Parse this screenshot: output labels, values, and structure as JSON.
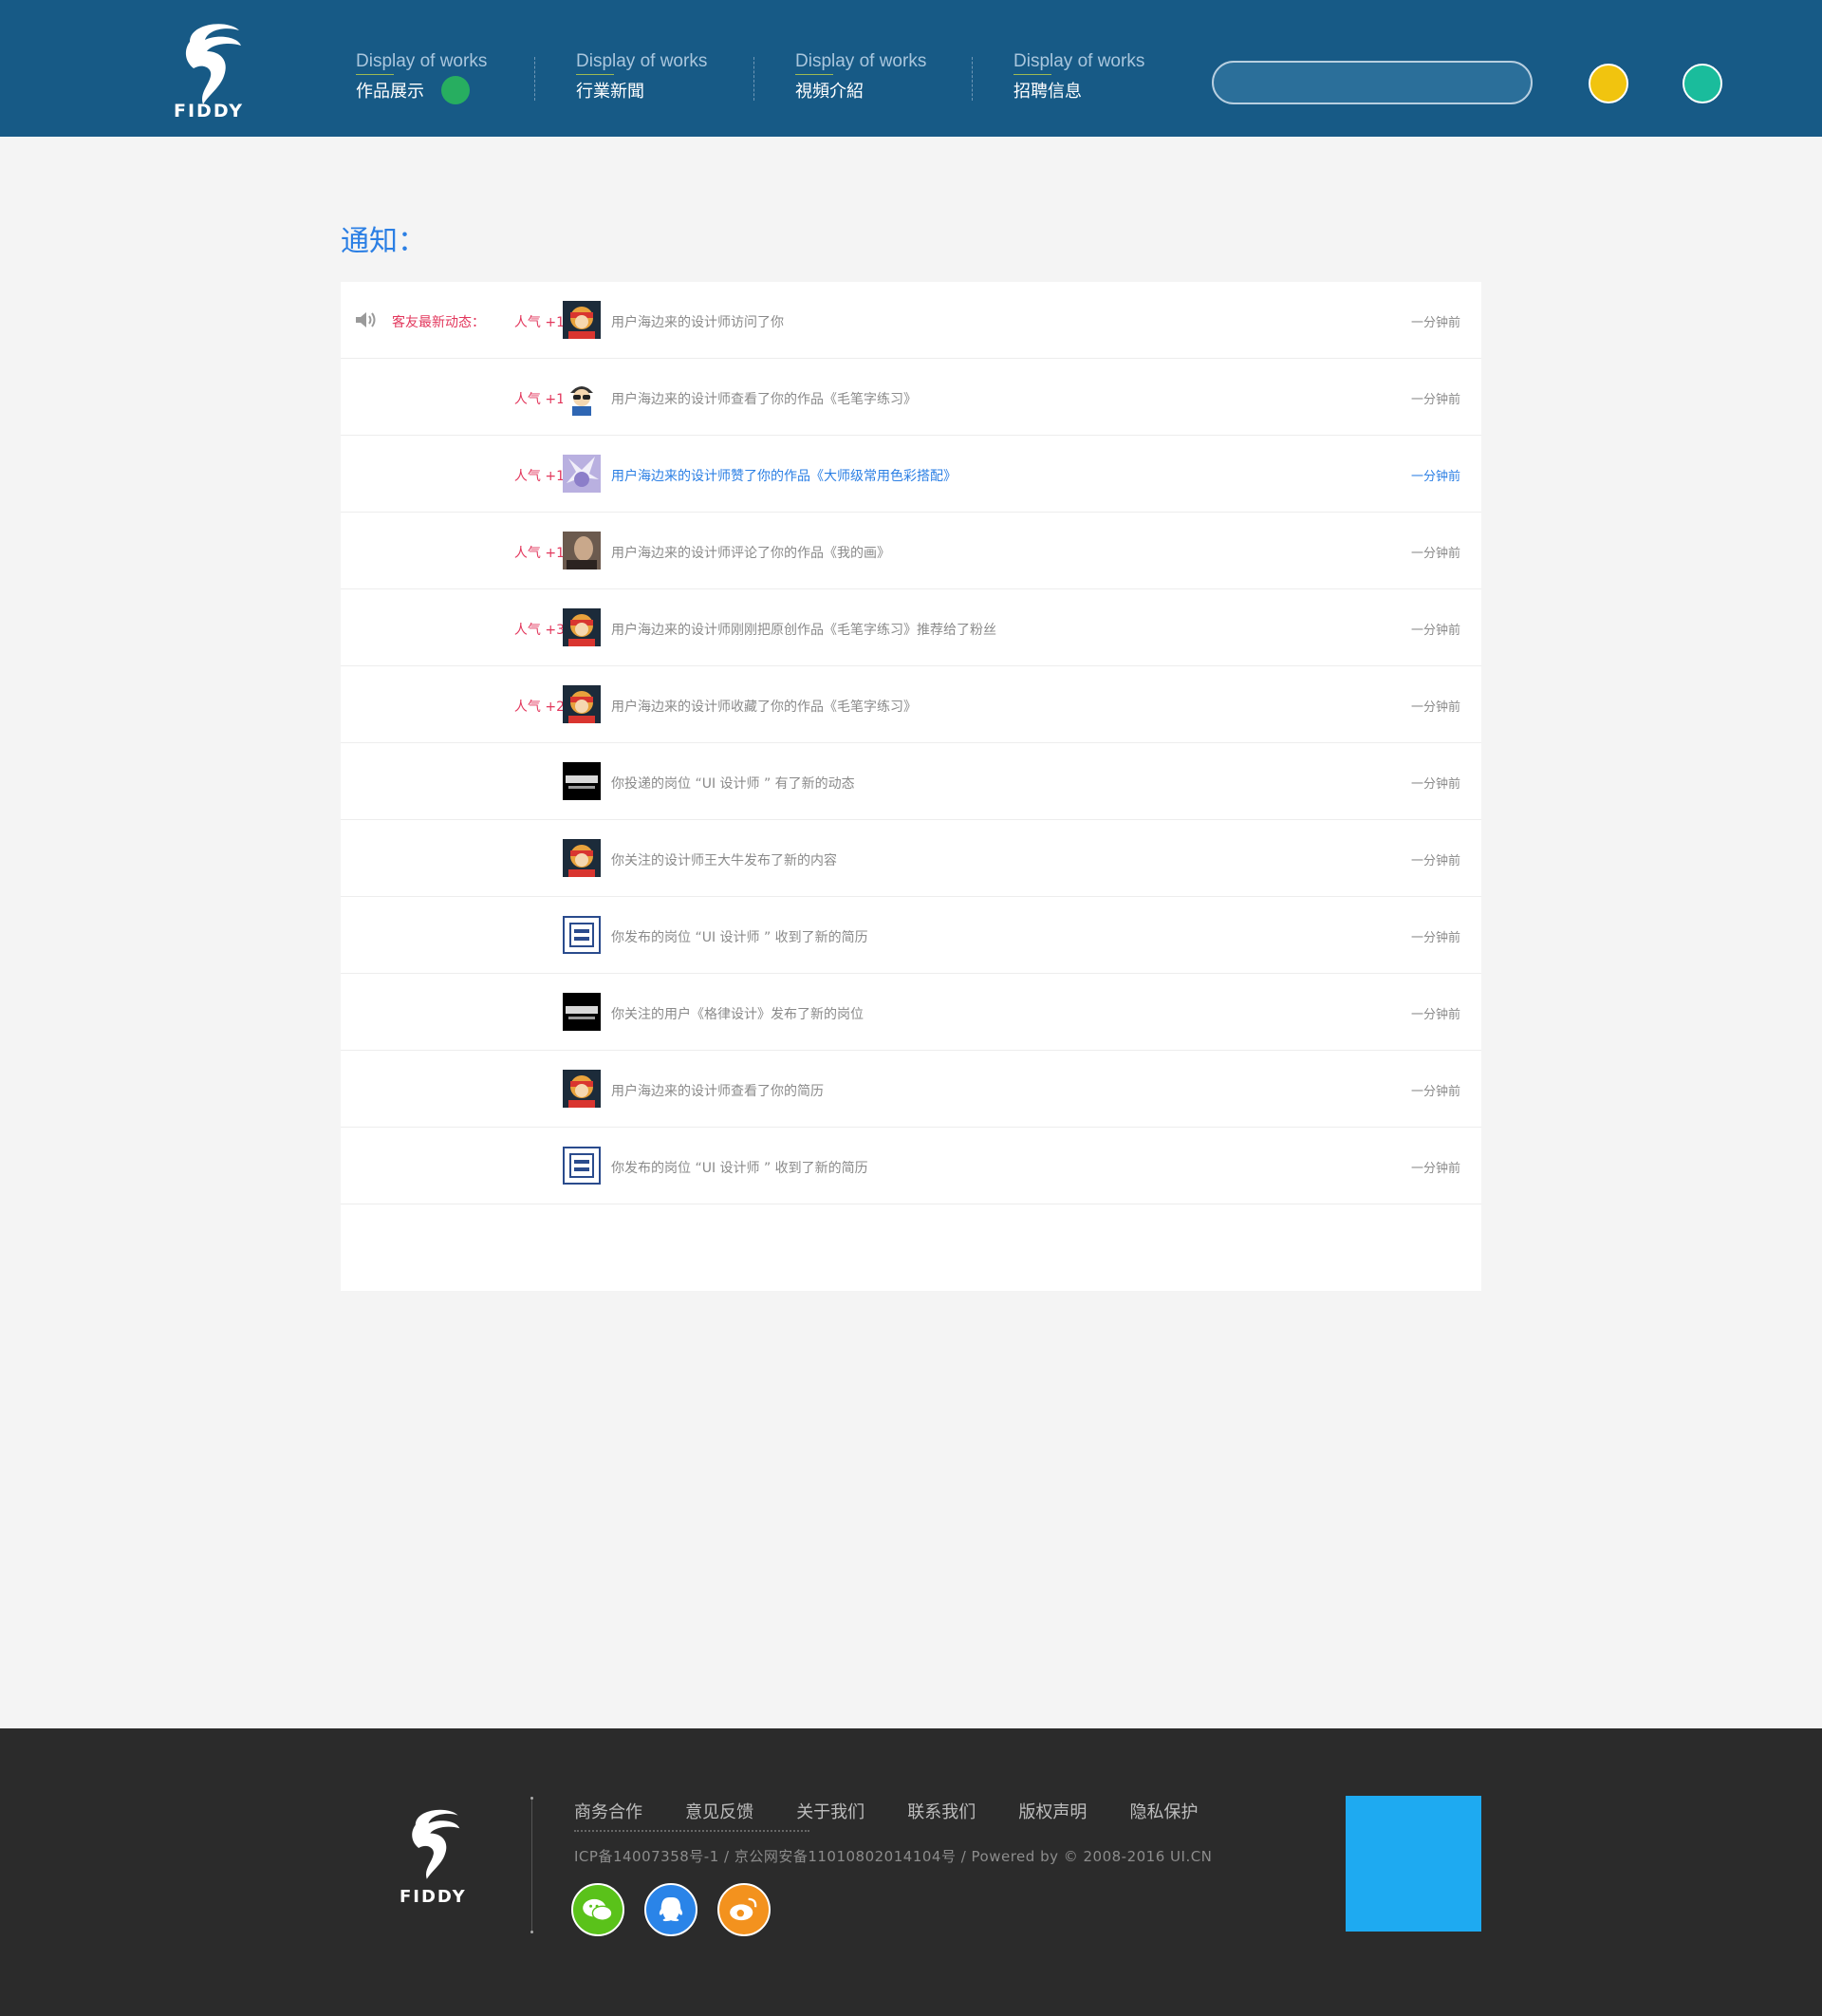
{
  "header": {
    "logo_text": "FIDDY",
    "nav": [
      {
        "en": "Display of works",
        "cn": "作品展示"
      },
      {
        "en": "Display of works",
        "cn": "行業新聞"
      },
      {
        "en": "Display of works",
        "cn": "視頻介紹"
      },
      {
        "en": "Display of works",
        "cn": "招聘信息"
      }
    ],
    "search_placeholder": "",
    "colors": {
      "bg": "#175a86",
      "active_dot": "#27ae60",
      "btn1": "#f1c40f",
      "btn2": "#1abc9c"
    }
  },
  "main": {
    "title": "通知：",
    "feed_label": "客友最新动态：",
    "rows": [
      {
        "pop": "人气 +1",
        "text": "用户海边来的设计师访问了你",
        "time": "一分钟前",
        "avatar": "avatar-a"
      },
      {
        "pop": "人气 +1",
        "text": "用户海边来的设计师查看了你的作品《毛笔字练习》",
        "time": "一分钟前",
        "avatar": "avatar-b"
      },
      {
        "pop": "人气 +1",
        "text": "用户海边来的设计师赞了你的作品《大师级常用色彩搭配》",
        "time": "一分钟前",
        "avatar": "avatar-c"
      },
      {
        "pop": "人气 +1",
        "text": "用户海边来的设计师评论了你的作品《我的画》",
        "time": "一分钟前",
        "avatar": "avatar-d"
      },
      {
        "pop": "人气 +3",
        "text": "用户海边来的设计师刚刚把原创作品《毛笔字练习》推荐给了粉丝",
        "time": "一分钟前",
        "avatar": "avatar-a"
      },
      {
        "pop": "人气 +2",
        "text": "用户海边来的设计师收藏了你的作品《毛笔字练习》",
        "time": "一分钟前",
        "avatar": "avatar-a"
      },
      {
        "pop": "",
        "text": "你投递的岗位 “UI 设计师 ” 有了新的动态",
        "time": "一分钟前",
        "avatar": "avatar-e"
      },
      {
        "pop": "",
        "text": "你关注的设计师王大牛发布了新的内容",
        "time": "一分钟前",
        "avatar": "avatar-a"
      },
      {
        "pop": "",
        "text": "你发布的岗位 “UI 设计师 ” 收到了新的简历",
        "time": "一分钟前",
        "avatar": "avatar-f"
      },
      {
        "pop": "",
        "text": "你关注的用户《格律设计》发布了新的岗位",
        "time": "一分钟前",
        "avatar": "avatar-e"
      },
      {
        "pop": "",
        "text": "用户海边来的设计师查看了你的简历",
        "time": "一分钟前",
        "avatar": "avatar-a"
      },
      {
        "pop": "",
        "text": "你发布的岗位 “UI 设计师 ” 收到了新的简历",
        "time": "一分钟前",
        "avatar": "avatar-f"
      }
    ],
    "highlight_color": "#2b7fe4",
    "label_color": "#e2375c"
  },
  "footer": {
    "logo_text": "FIDDY",
    "links": [
      "商务合作",
      "意见反馈",
      "关于我们",
      "联系我们",
      "版权声明",
      "隐私保护"
    ],
    "copyright": "ICP备14007358号-1 / 京公网安备11010802014104号 / Powered by © 2008-2016 UI.CN",
    "social": [
      {
        "name": "wechat-icon",
        "color": "#5ac21a"
      },
      {
        "name": "qq-icon",
        "color": "#2a84e8"
      },
      {
        "name": "weibo-icon",
        "color": "#f3921e"
      }
    ],
    "qr_color": "#1eaaf1"
  }
}
